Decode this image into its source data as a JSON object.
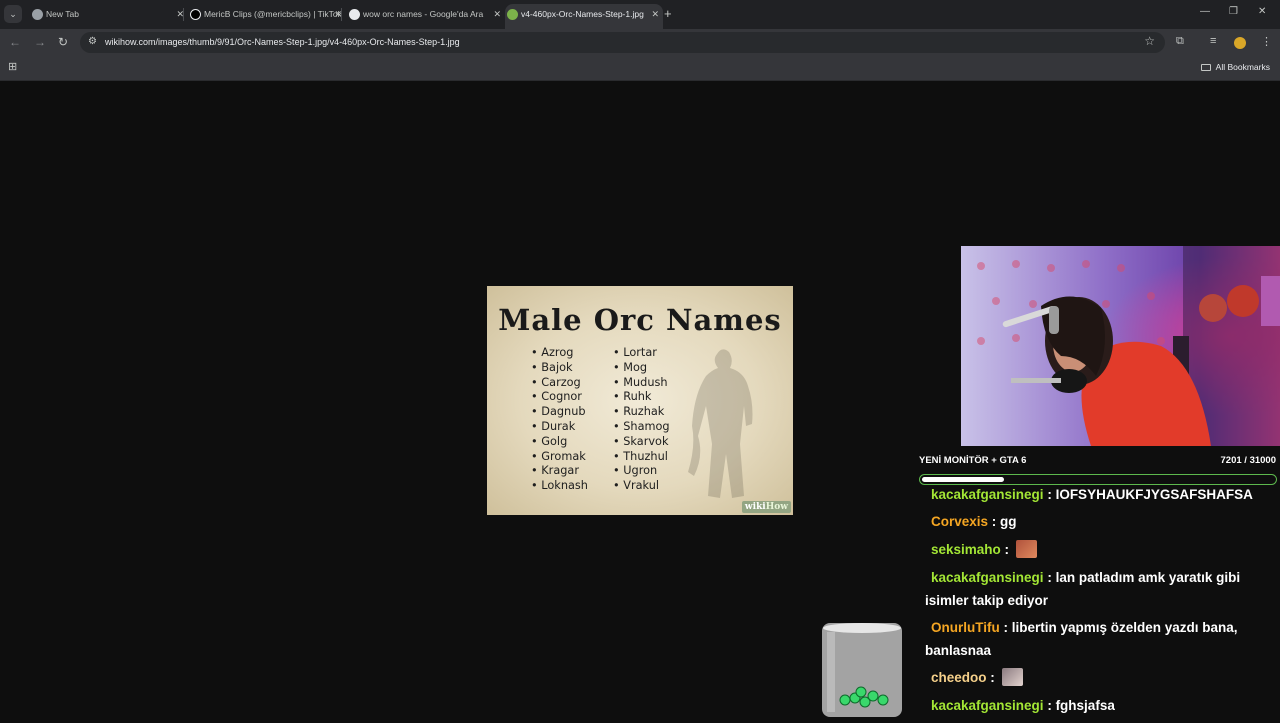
{
  "browser": {
    "tabs": [
      {
        "title": "New Tab",
        "favicon": "chrome-icon",
        "active": false
      },
      {
        "title": "MericB Clips (@mericbclips) | TikTok",
        "favicon": "tiktok-icon",
        "active": false
      },
      {
        "title": "wow orc names - Google'da Ara",
        "favicon": "google-icon",
        "active": false
      },
      {
        "title": "v4-460px-Orc-Names-Step-1.jpg",
        "favicon": "wikihow-icon",
        "active": true
      }
    ],
    "url": "wikihow.com/images/thumb/9/91/Orc-Names-Step-1.jpg/v4-460px-Orc-Names-Step-1.jpg",
    "bookmarks_label": "All Bookmarks",
    "icons": [
      "back-icon",
      "forward-icon",
      "reload-icon",
      "site-info-icon",
      "bookmark-star-icon",
      "extensions-icon",
      "media-icon",
      "profile-icon",
      "menu-icon"
    ]
  },
  "image": {
    "title": "Male Orc Names",
    "col1": [
      "Azrog",
      "Bajok",
      "Carzog",
      "Cognor",
      "Dagnub",
      "Durak",
      "Golg",
      "Gromak",
      "Kragar",
      "Loknash"
    ],
    "col2": [
      "Lortar",
      "Mog",
      "Mudush",
      "Ruhk",
      "Ruzhak",
      "Shamog",
      "Skarvok",
      "Thuzhul",
      "Ugron",
      "Vrakul"
    ],
    "watermark_a": "wiki",
    "watermark_b": "How"
  },
  "overlay": {
    "goal": {
      "label": "YENİ MONİTÖR + GTA 6",
      "count": "7201 / 31000",
      "current": 7201,
      "target": 31000
    },
    "chat": [
      {
        "user": "kacakafgansinegi",
        "sep": " : ",
        "text": "IOFSYHAUKFJYGSAFSHAFSA",
        "color": "#a3e635",
        "emote": null
      },
      {
        "user": "Corvexis",
        "sep": " : ",
        "text": "gg",
        "color": "#f5a623",
        "emote": null
      },
      {
        "user": "seksimaho",
        "sep": " : ",
        "text": "",
        "color": "#a3e635",
        "emote": "emote-1"
      },
      {
        "user": "kacakafgansinegi",
        "sep": " : ",
        "text": "lan patladım amk yaratık gibi isimler takip ediyor",
        "color": "#a3e635",
        "emote": null
      },
      {
        "user": "OnurluTifu",
        "sep": " : ",
        "text": "libertin yapmış özelden yazdı bana, banlasnaa",
        "color": "#f5a623",
        "emote": null
      },
      {
        "user": "cheedoo",
        "sep": " : ",
        "text": "",
        "color": "#f5d08a",
        "emote": "emote-2"
      },
      {
        "user": "kacakafgansinegi",
        "sep": " : ",
        "text": "fghsjafsa",
        "color": "#a3e635",
        "emote": null
      }
    ]
  }
}
